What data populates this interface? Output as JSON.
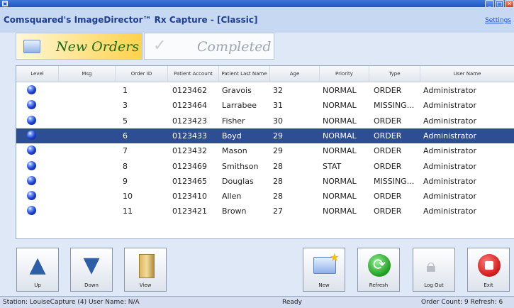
{
  "window": {
    "app_title": "Comsquared's ImageDirector™ Rx Capture - [Classic]",
    "settings_link": "Settings"
  },
  "tabs": [
    {
      "label": "New Orders"
    },
    {
      "label": "Completed"
    }
  ],
  "table": {
    "headers": [
      "Level",
      "Msg",
      "Order ID",
      "Patient Account",
      "Patient Last Name",
      "Age",
      "Priority",
      "Type",
      "User Name"
    ],
    "rows": [
      {
        "order_id": "1",
        "account": "0123462",
        "last_name": "Gravois",
        "age": "32",
        "priority": "NORMAL",
        "type": "ORDER",
        "user": "Administrator"
      },
      {
        "order_id": "3",
        "account": "0123464",
        "last_name": "Larrabee",
        "age": "31",
        "priority": "NORMAL",
        "type": "MISSING...",
        "user": "Administrator"
      },
      {
        "order_id": "5",
        "account": "0123423",
        "last_name": "Fisher",
        "age": "30",
        "priority": "NORMAL",
        "type": "ORDER",
        "user": "Administrator"
      },
      {
        "order_id": "6",
        "account": "0123433",
        "last_name": "Boyd",
        "age": "29",
        "priority": "NORMAL",
        "type": "ORDER",
        "user": "Administrator",
        "selected": true
      },
      {
        "order_id": "7",
        "account": "0123432",
        "last_name": "Mason",
        "age": "29",
        "priority": "NORMAL",
        "type": "ORDER",
        "user": "Administrator"
      },
      {
        "order_id": "8",
        "account": "0123469",
        "last_name": "Smithson",
        "age": "28",
        "priority": "STAT",
        "type": "ORDER",
        "user": "Administrator"
      },
      {
        "order_id": "9",
        "account": "0123465",
        "last_name": "Douglas",
        "age": "28",
        "priority": "NORMAL",
        "type": "MISSING...",
        "user": "Administrator"
      },
      {
        "order_id": "10",
        "account": "0123410",
        "last_name": "Allen",
        "age": "28",
        "priority": "NORMAL",
        "type": "ORDER",
        "user": "Administrator"
      },
      {
        "order_id": "11",
        "account": "0123421",
        "last_name": "Brown",
        "age": "27",
        "priority": "NORMAL",
        "type": "ORDER",
        "user": "Administrator"
      }
    ],
    "level_icon": "blue-ball-icon",
    "selected_row_color": "#2e4e93"
  },
  "toolbar": {
    "up_label": "Up",
    "down_label": "Down",
    "views_label": "View",
    "new_label": "New",
    "refresh_label": "Refresh",
    "logout_label": "Log Out",
    "exit_label": "Exit"
  },
  "status": {
    "station": "Station: LouiseCapture (4)  User Name: N/A",
    "state": "Ready",
    "counts": "Order Count: 9  Refresh: 6"
  }
}
